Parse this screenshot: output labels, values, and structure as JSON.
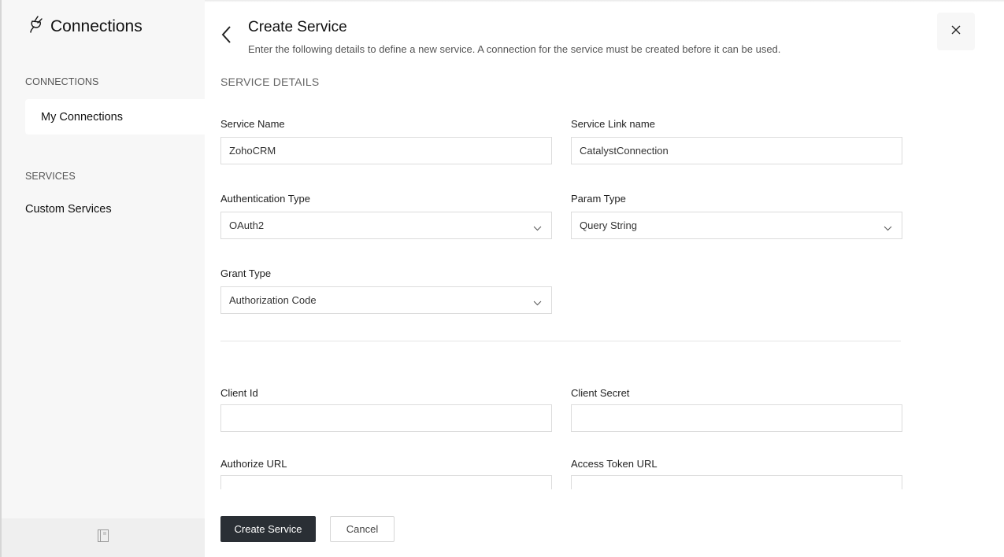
{
  "sidebar": {
    "app_title": "Connections",
    "sections": [
      {
        "label": "CONNECTIONS",
        "items": [
          {
            "label": "My Connections",
            "active": true
          }
        ]
      },
      {
        "label": "SERVICES",
        "items": [
          {
            "label": "Custom Services",
            "active": false
          }
        ]
      }
    ],
    "footer_icon": "docs-icon"
  },
  "header": {
    "title": "Create Service",
    "subtitle": "Enter the following details to define a new service. A connection for the service must be created before it can be used."
  },
  "form": {
    "section_title": "SERVICE DETAILS",
    "service_name": {
      "label": "Service Name",
      "value": "ZohoCRM"
    },
    "service_link_name": {
      "label": "Service Link name",
      "value": "CatalystConnection"
    },
    "authentication_type": {
      "label": "Authentication Type",
      "value": "OAuth2"
    },
    "param_type": {
      "label": "Param Type",
      "value": "Query String"
    },
    "grant_type": {
      "label": "Grant Type",
      "value": "Authorization Code"
    },
    "client_id": {
      "label": "Client Id",
      "value": ""
    },
    "client_secret": {
      "label": "Client Secret",
      "value": ""
    },
    "authorize_url": {
      "label": "Authorize URL",
      "value": ""
    },
    "access_token_url": {
      "label": "Access Token URL",
      "value": ""
    }
  },
  "actions": {
    "create_label": "Create Service",
    "cancel_label": "Cancel"
  }
}
